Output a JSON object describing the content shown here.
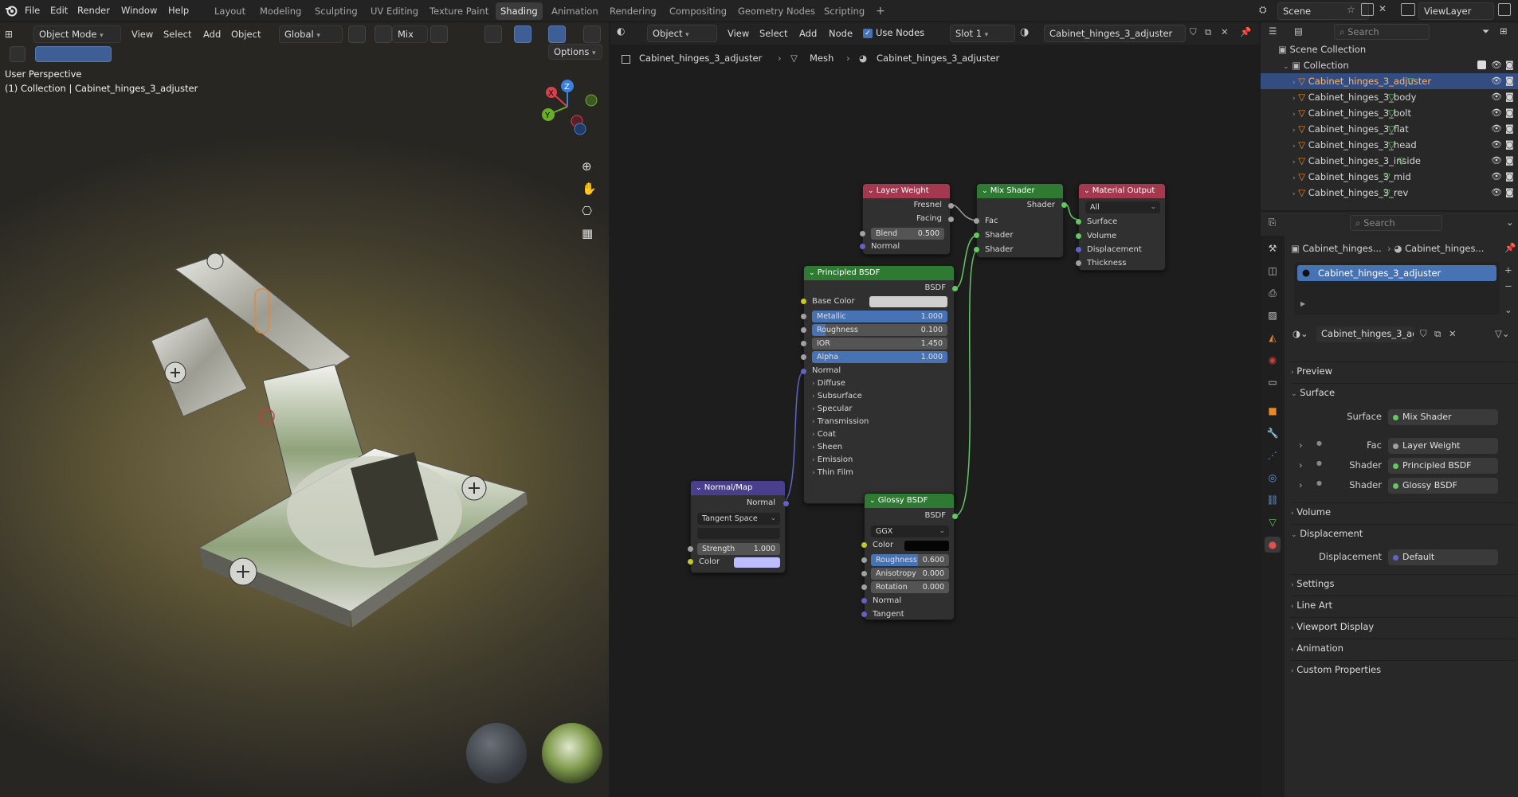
{
  "menu": {
    "file": "File",
    "edit": "Edit",
    "render": "Render",
    "window": "Window",
    "help": "Help"
  },
  "workspaces": [
    "Layout",
    "Modeling",
    "Sculpting",
    "UV Editing",
    "Texture Paint",
    "Shading",
    "Animation",
    "Rendering",
    "Compositing",
    "Geometry Nodes",
    "Scripting"
  ],
  "active_workspace": "Shading",
  "add_workspace": "+",
  "scene": {
    "name": "Scene",
    "view_layer": "ViewLayer"
  },
  "viewport": {
    "mode": "Object Mode",
    "view": "View",
    "select": "Select",
    "add": "Add",
    "object": "Object",
    "transform": "Global",
    "shading_mix": "Mix",
    "options": "Options",
    "overlay_title": "User Perspective",
    "overlay_sub": "(1) Collection | Cabinet_hinges_3_adjuster",
    "gizmo": {
      "x": "X",
      "y": "Y",
      "z": "Z"
    }
  },
  "node_editor": {
    "type": "Object",
    "view": "View",
    "select": "Select",
    "add": "Add",
    "node": "Node",
    "use_nodes": "Use Nodes",
    "slot": "Slot 1",
    "material": "Cabinet_hinges_3_adjuster",
    "breadcrumb": [
      "Cabinet_hinges_3_adjuster",
      "Mesh",
      "Cabinet_hinges_3_adjuster"
    ],
    "nodes": {
      "layer_weight": {
        "title": "Layer Weight",
        "fresnel": "Fresnel",
        "facing": "Facing",
        "blend_label": "Blend",
        "blend": "0.500",
        "normal": "Normal"
      },
      "mix_shader": {
        "title": "Mix Shader",
        "shader_out": "Shader",
        "fac": "Fac",
        "shader1": "Shader",
        "shader2": "Shader"
      },
      "material_output": {
        "title": "Material Output",
        "target": "All",
        "surface": "Surface",
        "volume": "Volume",
        "displacement": "Displacement",
        "thickness": "Thickness"
      },
      "principled": {
        "title": "Principled BSDF",
        "bsdf": "BSDF",
        "base_color": "Base Color",
        "metallic_label": "Metallic",
        "metallic": "1.000",
        "roughness_label": "Roughness",
        "roughness": "0.100",
        "ior_label": "IOR",
        "ior": "1.450",
        "alpha_label": "Alpha",
        "alpha": "1.000",
        "normal": "Normal",
        "panels": [
          "Diffuse",
          "Subsurface",
          "Specular",
          "Transmission",
          "Coat",
          "Sheen",
          "Emission",
          "Thin Film"
        ]
      },
      "normal_map": {
        "title": "Normal/Map",
        "normal": "Normal",
        "space": "Tangent Space",
        "strength_label": "Strength",
        "strength": "1.000",
        "color": "Color"
      },
      "glossy": {
        "title": "Glossy BSDF",
        "bsdf": "BSDF",
        "dist": "GGX",
        "color": "Color",
        "roughness_label": "Roughness",
        "roughness": "0.600",
        "aniso_label": "Anisotropy",
        "aniso": "0.000",
        "rotation_label": "Rotation",
        "rotation": "0.000",
        "normal": "Normal",
        "tangent": "Tangent"
      }
    }
  },
  "outliner": {
    "search_placeholder": "Search",
    "scene_collection": "Scene Collection",
    "collection": "Collection",
    "objects": [
      "Cabinet_hinges_3_adjuster",
      "Cabinet_hinges_3_body",
      "Cabinet_hinges_3_bolt",
      "Cabinet_hinges_3_flat",
      "Cabinet_hinges_3_head",
      "Cabinet_hinges_3_inside",
      "Cabinet_hinges_3_mid",
      "Cabinet_hinges_3_rev"
    ]
  },
  "properties": {
    "search_placeholder": "Search",
    "crumb1": "Cabinet_hinges...",
    "crumb2": "Cabinet_hinges...",
    "slot_item": "Cabinet_hinges_3_adjuster",
    "material_name": "Cabinet_hinges_3_adjuster",
    "sections": {
      "preview": "Preview",
      "surface": "Surface",
      "volume": "Volume",
      "displacement": "Displacement",
      "settings": "Settings",
      "line_art": "Line Art",
      "viewport_display": "Viewport Display",
      "animation": "Animation",
      "custom_props": "Custom Properties"
    },
    "surface_label": "Surface",
    "surface_val": "Mix Shader",
    "fac_label": "Fac",
    "fac_val": "Layer Weight",
    "shader1_label": "Shader",
    "shader1_val": "Principled BSDF",
    "shader2_label": "Shader",
    "shader2_val": "Glossy BSDF",
    "disp_label": "Displacement",
    "disp_val": "Default"
  },
  "colors": {
    "accent": "#4772b3",
    "shader_green": "#63c763",
    "selected_row": "#334d80"
  }
}
